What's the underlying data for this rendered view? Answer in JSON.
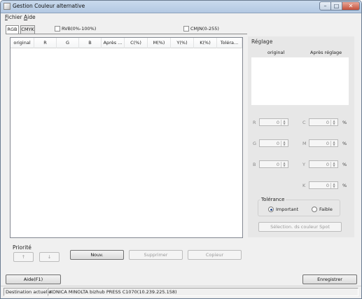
{
  "window": {
    "title": "Gestion Couleur alternative"
  },
  "menu": [
    "Fichier",
    "Aide"
  ],
  "tabs": [
    {
      "label": "RGB"
    },
    {
      "label": "CMYK"
    }
  ],
  "checkboxes": {
    "rvb": "RVB(0%-100%)",
    "cmjn": "CMJN(0-255)"
  },
  "list": {
    "columns": [
      "original",
      "R",
      "G",
      "B",
      "Après ...",
      "C(%)",
      "M(%)",
      "Y(%)",
      "K(%)",
      "Toléra..."
    ]
  },
  "reglage": {
    "title": "Réglage",
    "col_original": "original",
    "col_apres": "Après réglage",
    "fields": [
      {
        "label": "R",
        "value": "0"
      },
      {
        "label": "G",
        "value": "0"
      },
      {
        "label": "B",
        "value": "0"
      },
      {
        "label": "C",
        "value": "0",
        "unit": "%"
      },
      {
        "label": "M",
        "value": "0",
        "unit": "%"
      },
      {
        "label": "Y",
        "value": "0",
        "unit": "%"
      },
      {
        "label": "K",
        "value": "0",
        "unit": "%"
      }
    ],
    "tolerance": {
      "title": "Tolérance",
      "important": "Important",
      "faible": "Faible",
      "selected": "Important"
    },
    "spot_button": "Sélection. ds couleur Spot"
  },
  "priority": {
    "label": "Priorité",
    "up": "↑",
    "down": "↓"
  },
  "buttons": {
    "nouv": "Nouv.",
    "supprimer": "Supprimer",
    "copier": "Copieur",
    "aide": "Aide(F1)",
    "enregistrer": "Enregistrer"
  },
  "status": {
    "label": "Destination actuelle",
    "value": "KONICA MINOLTA bizhub PRESS C1070(10.239.225.158)"
  }
}
